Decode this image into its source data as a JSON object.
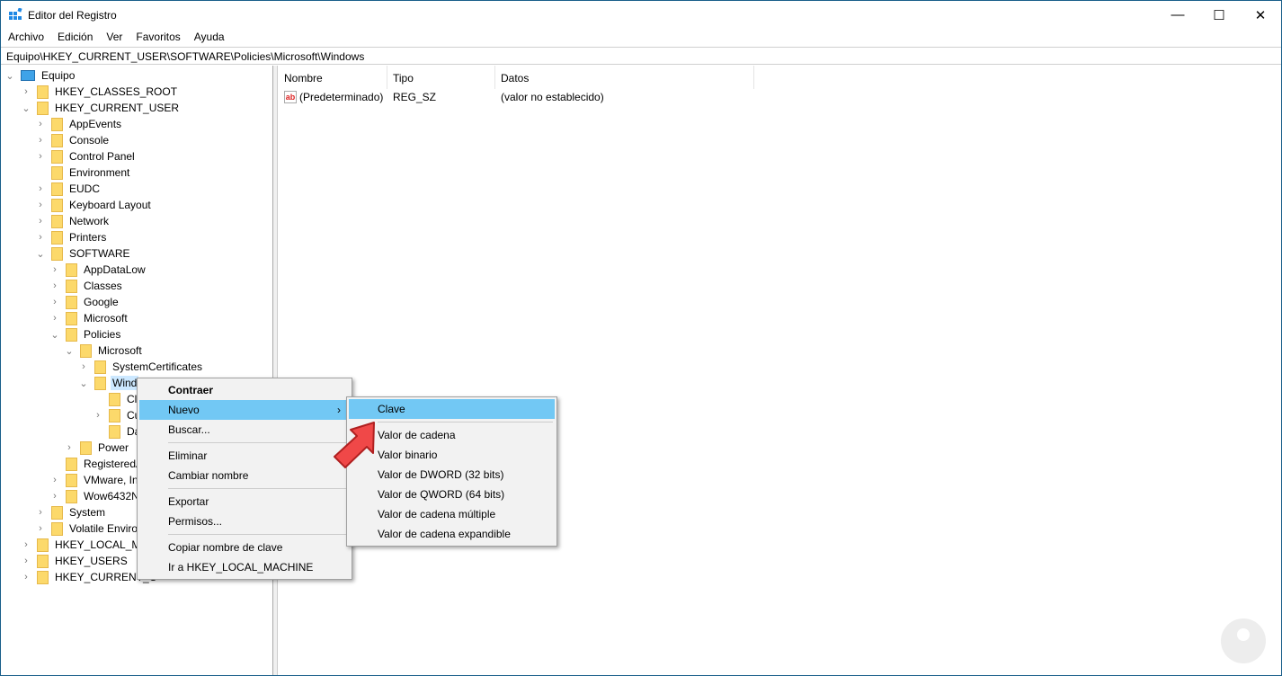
{
  "window": {
    "title": "Editor del Registro",
    "minimize": "—",
    "maximize": "☐",
    "close": "✕"
  },
  "menubar": [
    "Archivo",
    "Edición",
    "Ver",
    "Favoritos",
    "Ayuda"
  ],
  "address": "Equipo\\HKEY_CURRENT_USER\\SOFTWARE\\Policies\\Microsoft\\Windows",
  "tree": [
    {
      "label": "Equipo",
      "level": 0,
      "state": "open",
      "icon": "computer"
    },
    {
      "label": "HKEY_CLASSES_ROOT",
      "level": 1,
      "state": "closed"
    },
    {
      "label": "HKEY_CURRENT_USER",
      "level": 1,
      "state": "open"
    },
    {
      "label": "AppEvents",
      "level": 2,
      "state": "closed"
    },
    {
      "label": "Console",
      "level": 2,
      "state": "closed"
    },
    {
      "label": "Control Panel",
      "level": 2,
      "state": "closed"
    },
    {
      "label": "Environment",
      "level": 2,
      "state": "leaf"
    },
    {
      "label": "EUDC",
      "level": 2,
      "state": "closed"
    },
    {
      "label": "Keyboard Layout",
      "level": 2,
      "state": "closed"
    },
    {
      "label": "Network",
      "level": 2,
      "state": "closed"
    },
    {
      "label": "Printers",
      "level": 2,
      "state": "closed"
    },
    {
      "label": "SOFTWARE",
      "level": 2,
      "state": "open"
    },
    {
      "label": "AppDataLow",
      "level": 3,
      "state": "closed"
    },
    {
      "label": "Classes",
      "level": 3,
      "state": "closed"
    },
    {
      "label": "Google",
      "level": 3,
      "state": "closed"
    },
    {
      "label": "Microsoft",
      "level": 3,
      "state": "closed"
    },
    {
      "label": "Policies",
      "level": 3,
      "state": "open"
    },
    {
      "label": "Microsoft",
      "level": 4,
      "state": "open"
    },
    {
      "label": "SystemCertificates",
      "level": 5,
      "state": "closed"
    },
    {
      "label": "Wind",
      "level": 5,
      "state": "open",
      "selected": true
    },
    {
      "label": "Cl",
      "level": 6,
      "state": "leaf"
    },
    {
      "label": "Cu",
      "level": 6,
      "state": "closed"
    },
    {
      "label": "Da",
      "level": 6,
      "state": "leaf"
    },
    {
      "label": "Power",
      "level": 4,
      "state": "closed"
    },
    {
      "label": "RegisteredA",
      "level": 3,
      "state": "leaf"
    },
    {
      "label": "VMware, Inc",
      "level": 3,
      "state": "closed"
    },
    {
      "label": "Wow6432N",
      "level": 3,
      "state": "closed"
    },
    {
      "label": "System",
      "level": 2,
      "state": "closed"
    },
    {
      "label": "Volatile Enviror",
      "level": 2,
      "state": "closed"
    },
    {
      "label": "HKEY_LOCAL_MA",
      "level": 1,
      "state": "closed"
    },
    {
      "label": "HKEY_USERS",
      "level": 1,
      "state": "closed"
    },
    {
      "label": "HKEY_CURRENT_C",
      "level": 1,
      "state": "closed"
    }
  ],
  "columns": {
    "name": "Nombre",
    "type": "Tipo",
    "data": "Datos"
  },
  "values": [
    {
      "name": "(Predeterminado)",
      "type": "REG_SZ",
      "data": "(valor no establecido)",
      "icon": "ab"
    }
  ],
  "context_menu": {
    "collapse": "Contraer",
    "new": "Nuevo",
    "find": "Buscar...",
    "delete": "Eliminar",
    "rename": "Cambiar nombre",
    "export": "Exportar",
    "permissions": "Permisos...",
    "copy_key": "Copiar nombre de clave",
    "goto": "Ir a HKEY_LOCAL_MACHINE",
    "submenu_arrow": "›"
  },
  "submenu": {
    "key": "Clave",
    "string": "Valor de cadena",
    "binary": "Valor binario",
    "dword": "Valor de DWORD (32 bits)",
    "qword": "Valor de QWORD (64 bits)",
    "multi": "Valor de cadena múltiple",
    "expand": "Valor de cadena expandible"
  }
}
